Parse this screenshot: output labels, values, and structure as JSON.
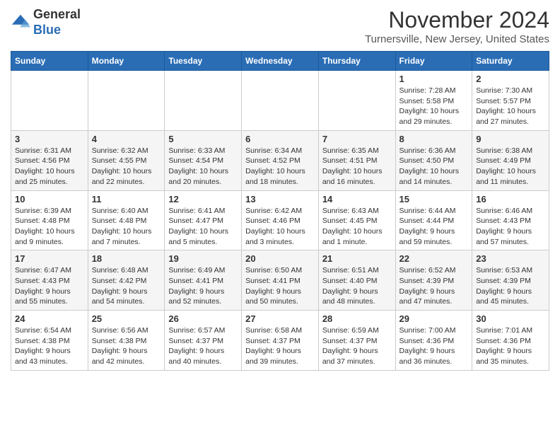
{
  "logo": {
    "general": "General",
    "blue": "Blue"
  },
  "header": {
    "month": "November 2024",
    "location": "Turnersville, New Jersey, United States"
  },
  "weekdays": [
    "Sunday",
    "Monday",
    "Tuesday",
    "Wednesday",
    "Thursday",
    "Friday",
    "Saturday"
  ],
  "weeks": [
    [
      {
        "day": "",
        "info": ""
      },
      {
        "day": "",
        "info": ""
      },
      {
        "day": "",
        "info": ""
      },
      {
        "day": "",
        "info": ""
      },
      {
        "day": "",
        "info": ""
      },
      {
        "day": "1",
        "info": "Sunrise: 7:28 AM\nSunset: 5:58 PM\nDaylight: 10 hours and 29 minutes."
      },
      {
        "day": "2",
        "info": "Sunrise: 7:30 AM\nSunset: 5:57 PM\nDaylight: 10 hours and 27 minutes."
      }
    ],
    [
      {
        "day": "3",
        "info": "Sunrise: 6:31 AM\nSunset: 4:56 PM\nDaylight: 10 hours and 25 minutes."
      },
      {
        "day": "4",
        "info": "Sunrise: 6:32 AM\nSunset: 4:55 PM\nDaylight: 10 hours and 22 minutes."
      },
      {
        "day": "5",
        "info": "Sunrise: 6:33 AM\nSunset: 4:54 PM\nDaylight: 10 hours and 20 minutes."
      },
      {
        "day": "6",
        "info": "Sunrise: 6:34 AM\nSunset: 4:52 PM\nDaylight: 10 hours and 18 minutes."
      },
      {
        "day": "7",
        "info": "Sunrise: 6:35 AM\nSunset: 4:51 PM\nDaylight: 10 hours and 16 minutes."
      },
      {
        "day": "8",
        "info": "Sunrise: 6:36 AM\nSunset: 4:50 PM\nDaylight: 10 hours and 14 minutes."
      },
      {
        "day": "9",
        "info": "Sunrise: 6:38 AM\nSunset: 4:49 PM\nDaylight: 10 hours and 11 minutes."
      }
    ],
    [
      {
        "day": "10",
        "info": "Sunrise: 6:39 AM\nSunset: 4:48 PM\nDaylight: 10 hours and 9 minutes."
      },
      {
        "day": "11",
        "info": "Sunrise: 6:40 AM\nSunset: 4:48 PM\nDaylight: 10 hours and 7 minutes."
      },
      {
        "day": "12",
        "info": "Sunrise: 6:41 AM\nSunset: 4:47 PM\nDaylight: 10 hours and 5 minutes."
      },
      {
        "day": "13",
        "info": "Sunrise: 6:42 AM\nSunset: 4:46 PM\nDaylight: 10 hours and 3 minutes."
      },
      {
        "day": "14",
        "info": "Sunrise: 6:43 AM\nSunset: 4:45 PM\nDaylight: 10 hours and 1 minute."
      },
      {
        "day": "15",
        "info": "Sunrise: 6:44 AM\nSunset: 4:44 PM\nDaylight: 9 hours and 59 minutes."
      },
      {
        "day": "16",
        "info": "Sunrise: 6:46 AM\nSunset: 4:43 PM\nDaylight: 9 hours and 57 minutes."
      }
    ],
    [
      {
        "day": "17",
        "info": "Sunrise: 6:47 AM\nSunset: 4:43 PM\nDaylight: 9 hours and 55 minutes."
      },
      {
        "day": "18",
        "info": "Sunrise: 6:48 AM\nSunset: 4:42 PM\nDaylight: 9 hours and 54 minutes."
      },
      {
        "day": "19",
        "info": "Sunrise: 6:49 AM\nSunset: 4:41 PM\nDaylight: 9 hours and 52 minutes."
      },
      {
        "day": "20",
        "info": "Sunrise: 6:50 AM\nSunset: 4:41 PM\nDaylight: 9 hours and 50 minutes."
      },
      {
        "day": "21",
        "info": "Sunrise: 6:51 AM\nSunset: 4:40 PM\nDaylight: 9 hours and 48 minutes."
      },
      {
        "day": "22",
        "info": "Sunrise: 6:52 AM\nSunset: 4:39 PM\nDaylight: 9 hours and 47 minutes."
      },
      {
        "day": "23",
        "info": "Sunrise: 6:53 AM\nSunset: 4:39 PM\nDaylight: 9 hours and 45 minutes."
      }
    ],
    [
      {
        "day": "24",
        "info": "Sunrise: 6:54 AM\nSunset: 4:38 PM\nDaylight: 9 hours and 43 minutes."
      },
      {
        "day": "25",
        "info": "Sunrise: 6:56 AM\nSunset: 4:38 PM\nDaylight: 9 hours and 42 minutes."
      },
      {
        "day": "26",
        "info": "Sunrise: 6:57 AM\nSunset: 4:37 PM\nDaylight: 9 hours and 40 minutes."
      },
      {
        "day": "27",
        "info": "Sunrise: 6:58 AM\nSunset: 4:37 PM\nDaylight: 9 hours and 39 minutes."
      },
      {
        "day": "28",
        "info": "Sunrise: 6:59 AM\nSunset: 4:37 PM\nDaylight: 9 hours and 37 minutes."
      },
      {
        "day": "29",
        "info": "Sunrise: 7:00 AM\nSunset: 4:36 PM\nDaylight: 9 hours and 36 minutes."
      },
      {
        "day": "30",
        "info": "Sunrise: 7:01 AM\nSunset: 4:36 PM\nDaylight: 9 hours and 35 minutes."
      }
    ]
  ]
}
